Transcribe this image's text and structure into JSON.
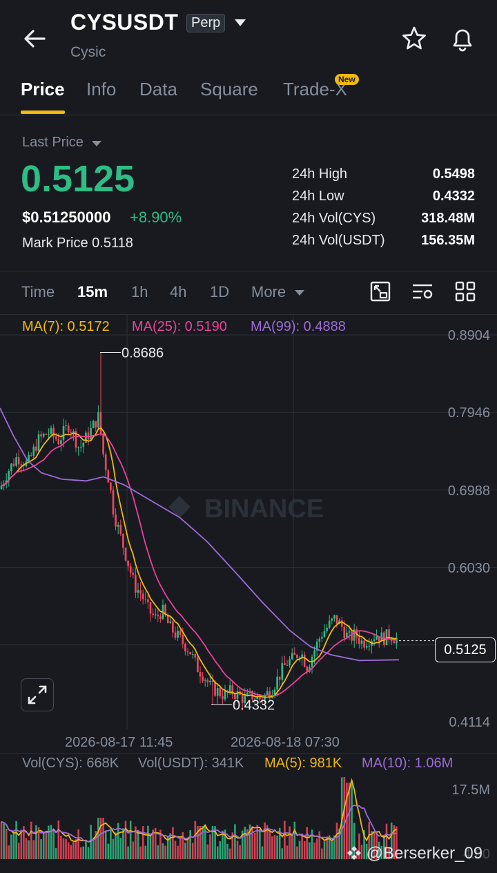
{
  "header": {
    "symbol": "CYSUSDT",
    "badge": "Perp",
    "name": "Cysic"
  },
  "tabs": [
    {
      "label": "Price"
    },
    {
      "label": "Info"
    },
    {
      "label": "Data"
    },
    {
      "label": "Square"
    },
    {
      "label": "Trade-X"
    }
  ],
  "new_badge": "New",
  "price_block": {
    "last_label": "Last Price",
    "last_price": "0.5125",
    "usd_price": "$0.51250000",
    "change": "+8.90%",
    "mark_label": "Mark Price",
    "mark_value": "0.5118",
    "stats": [
      {
        "label": "24h High",
        "value": "0.5498"
      },
      {
        "label": "24h Low",
        "value": "0.4332"
      },
      {
        "label": "24h Vol(CYS)",
        "value": "318.48M"
      },
      {
        "label": "24h Vol(USDT)",
        "value": "156.35M"
      }
    ]
  },
  "intervals": [
    {
      "label": "Time"
    },
    {
      "label": "15m"
    },
    {
      "label": "1h"
    },
    {
      "label": "4h"
    },
    {
      "label": "1D"
    },
    {
      "label": "More"
    }
  ],
  "ma_legend": [
    {
      "label": "MA(7): 0.5172",
      "color": "#f0b90b"
    },
    {
      "label": "MA(25): 0.5190",
      "color": "#e8439a"
    },
    {
      "label": "MA(99): 0.4888",
      "color": "#9d6bd6"
    }
  ],
  "chart_data": {
    "type": "candlestick",
    "y_axis_ticks": [
      "0.8904",
      "0.7946",
      "0.6988",
      "0.6030",
      "0.4114"
    ],
    "ylim": [
      0.4114,
      0.8904
    ],
    "current_price": "0.5125",
    "high_marker": "0.8686",
    "low_marker": "0.4332",
    "x_labels": [
      "2026-08-17 11:45",
      "2026-08-18 07:30"
    ],
    "colors": {
      "up": "#2ebd85",
      "down": "#f6465d",
      "ma7": "#f0b90b",
      "ma25": "#e8439a",
      "ma99": "#9d6bd6"
    }
  },
  "watermark_logo": "BINANCE",
  "volume": {
    "legend": [
      {
        "label": "Vol(CYS): 668K",
        "color": "#848e9c"
      },
      {
        "label": "Vol(USDT): 341K",
        "color": "#848e9c"
      },
      {
        "label": "MA(5): 981K",
        "color": "#f0b90b"
      },
      {
        "label": "MA(10): 1.06M",
        "color": "#9d6bd6"
      }
    ],
    "axis_top": "17.5M",
    "axis_bottom": "4.60"
  },
  "overlay_watermark": "@Berserker_09"
}
